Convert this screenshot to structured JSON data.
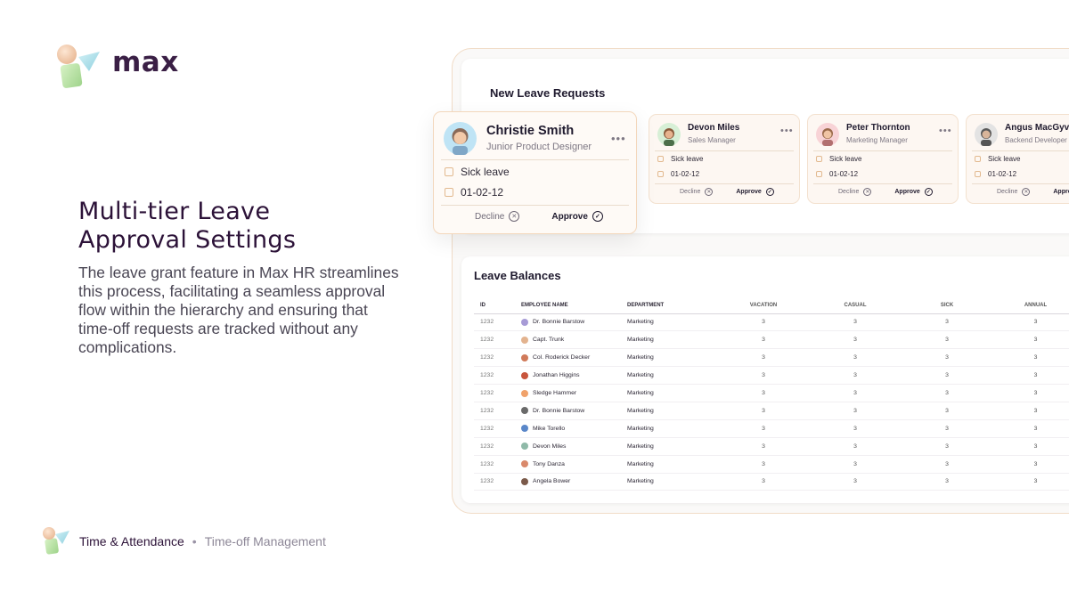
{
  "brand": {
    "name": "max"
  },
  "hero": {
    "title_line1": "Multi-tier Leave",
    "title_line2": "Approval Settings",
    "description": "The leave grant feature in Max HR streamlines this process, facilitating a seamless approval flow within the hierarchy and ensuring that time-off requests are tracked without any complications."
  },
  "footer": {
    "category": "Time & Attendance",
    "separator": "•",
    "subcategory": "Time-off Management"
  },
  "requests": {
    "title": "New Leave Requests",
    "decline_label": "Decline",
    "approve_label": "Approve",
    "items": [
      {
        "name": "Christie Smith",
        "role": "Junior Product Designer",
        "leave_type": "Sick leave",
        "date": "01-02-12"
      },
      {
        "name": "Devon Miles",
        "role": "Sales Manager",
        "leave_type": "Sick leave",
        "date": "01-02-12"
      },
      {
        "name": "Peter Thornton",
        "role": "Marketing Manager",
        "leave_type": "Sick leave",
        "date": "01-02-12"
      },
      {
        "name": "Angus MacGyver",
        "role": "Backend Developer",
        "leave_type": "Sick leave",
        "date": "01-02-12"
      }
    ]
  },
  "balances": {
    "title": "Leave Balances",
    "columns": [
      "ID",
      "EMPLOYEE NAME",
      "DEPARTMENT",
      "VACATION",
      "CASUAL",
      "SICK",
      "ANNUAL"
    ],
    "rows": [
      {
        "id": "1232",
        "name": "Dr. Bonnie Barstow",
        "dept": "Marketing",
        "vacation": "3",
        "casual": "3",
        "sick": "3",
        "annual": "3"
      },
      {
        "id": "1232",
        "name": "Capt. Trunk",
        "dept": "Marketing",
        "vacation": "3",
        "casual": "3",
        "sick": "3",
        "annual": "3"
      },
      {
        "id": "1232",
        "name": "Col. Roderick Decker",
        "dept": "Marketing",
        "vacation": "3",
        "casual": "3",
        "sick": "3",
        "annual": "3"
      },
      {
        "id": "1232",
        "name": "Jonathan Higgins",
        "dept": "Marketing",
        "vacation": "3",
        "casual": "3",
        "sick": "3",
        "annual": "3"
      },
      {
        "id": "1232",
        "name": "Sledge Hammer",
        "dept": "Marketing",
        "vacation": "3",
        "casual": "3",
        "sick": "3",
        "annual": "3"
      },
      {
        "id": "1232",
        "name": "Dr. Bonnie Barstow",
        "dept": "Marketing",
        "vacation": "3",
        "casual": "3",
        "sick": "3",
        "annual": "3"
      },
      {
        "id": "1232",
        "name": "Mike Torello",
        "dept": "Marketing",
        "vacation": "3",
        "casual": "3",
        "sick": "3",
        "annual": "3"
      },
      {
        "id": "1232",
        "name": "Devon Miles",
        "dept": "Marketing",
        "vacation": "3",
        "casual": "3",
        "sick": "3",
        "annual": "3"
      },
      {
        "id": "1232",
        "name": "Tony Danza",
        "dept": "Marketing",
        "vacation": "3",
        "casual": "3",
        "sick": "3",
        "annual": "3"
      },
      {
        "id": "1232",
        "name": "Angela Bower",
        "dept": "Marketing",
        "vacation": "3",
        "casual": "3",
        "sick": "3",
        "annual": "3"
      }
    ]
  },
  "colors": {
    "brand_purple": "#3a1f45",
    "accent_peach": "#f3d7bc",
    "card_bg": "#fdf7f2"
  }
}
